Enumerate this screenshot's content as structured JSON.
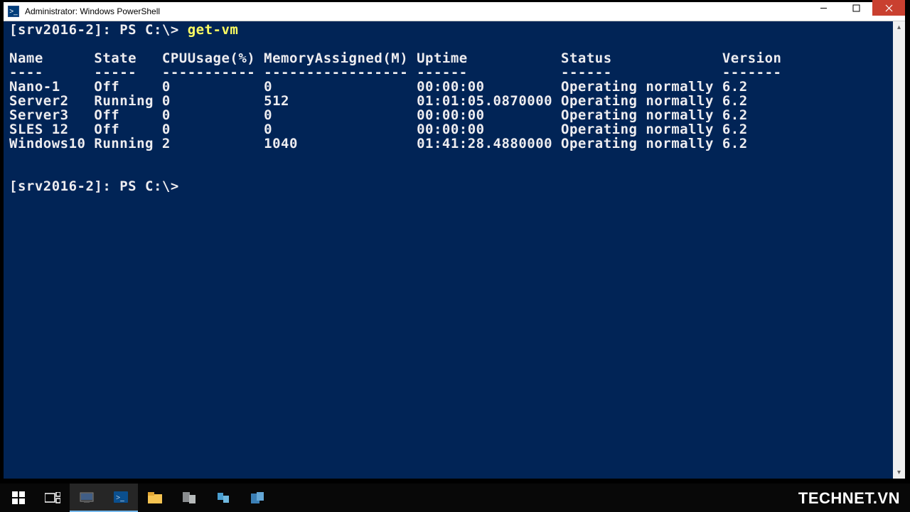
{
  "window": {
    "title": "Administrator: Windows PowerShell"
  },
  "terminal": {
    "prompt": "[srv2016-2]: PS C:\\>",
    "command": "get-vm",
    "columns": {
      "name": "Name",
      "state": "State",
      "cpu": "CPUUsage(%)",
      "mem": "MemoryAssigned(M)",
      "uptime": "Uptime",
      "status": "Status",
      "version": "Version"
    },
    "divs": {
      "name": "----",
      "state": "-----",
      "cpu": "-----------",
      "mem": "-----------------",
      "uptime": "------",
      "status": "------",
      "version": "-------"
    },
    "rows": [
      {
        "name": "Nano-1",
        "state": "Off",
        "cpu": "0",
        "mem": "0",
        "uptime": "00:00:00",
        "status": "Operating normally",
        "version": "6.2"
      },
      {
        "name": "Server2",
        "state": "Running",
        "cpu": "0",
        "mem": "512",
        "uptime": "01:01:05.0870000",
        "status": "Operating normally",
        "version": "6.2"
      },
      {
        "name": "Server3",
        "state": "Off",
        "cpu": "0",
        "mem": "0",
        "uptime": "00:00:00",
        "status": "Operating normally",
        "version": "6.2"
      },
      {
        "name": "SLES 12",
        "state": "Off",
        "cpu": "0",
        "mem": "0",
        "uptime": "00:00:00",
        "status": "Operating normally",
        "version": "6.2"
      },
      {
        "name": "Windows10",
        "state": "Running",
        "cpu": "2",
        "mem": "1040",
        "uptime": "01:41:28.4880000",
        "status": "Operating normally",
        "version": "6.2"
      }
    ],
    "trailing_prompt": "[srv2016-2]: PS C:\\>"
  },
  "watermark": "TECHNET.VN"
}
